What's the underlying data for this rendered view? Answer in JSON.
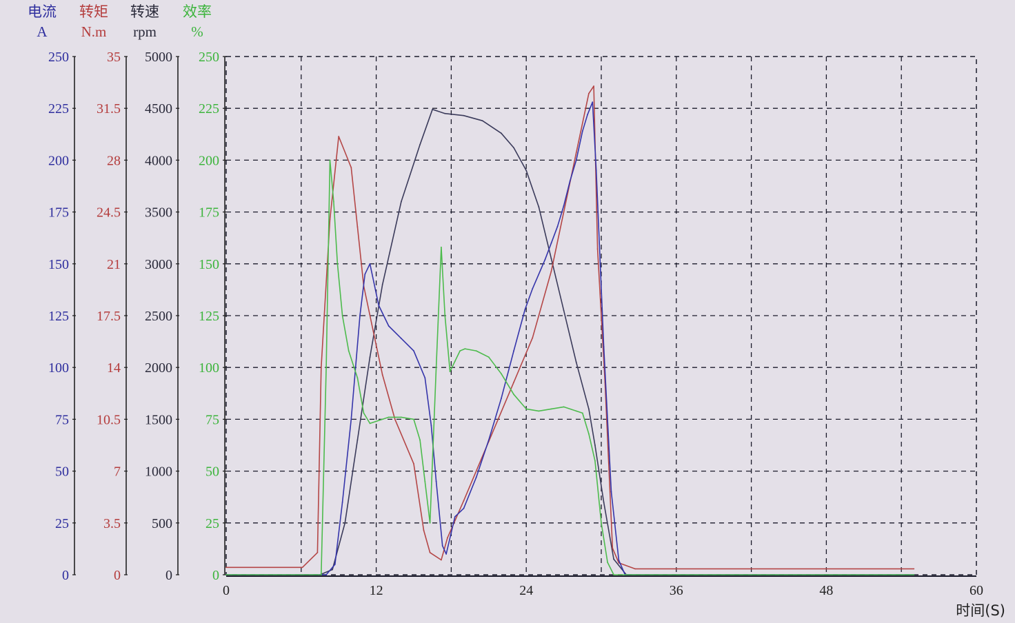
{
  "chart_data": {
    "type": "line",
    "xlabel": "时间(S)",
    "xlim": [
      0,
      60
    ],
    "x_ticks": [
      0,
      12,
      24,
      36,
      48,
      60
    ],
    "x_tick_labels": [
      "0",
      "12",
      "24",
      "36",
      "48",
      "60"
    ],
    "grid": true,
    "axes": [
      {
        "key": "current",
        "name": "电流",
        "unit": "A",
        "range": [
          0,
          250
        ],
        "color": "#2e2e9e",
        "tick_labels": [
          "0",
          "25",
          "50",
          "75",
          "100",
          "125",
          "150",
          "175",
          "200",
          "225",
          "250"
        ]
      },
      {
        "key": "torque",
        "name": "转矩",
        "unit": "N.m",
        "range": [
          0,
          35
        ],
        "color": "#b43c3c",
        "tick_labels": [
          "0",
          "3.5",
          "7",
          "10.5",
          "14",
          "17.5",
          "21",
          "24.5",
          "28",
          "31.5",
          "35"
        ]
      },
      {
        "key": "speed",
        "name": "转速",
        "unit": "rpm",
        "range": [
          0,
          5000
        ],
        "color": "#2a2a3a",
        "tick_labels": [
          "0",
          "500",
          "1000",
          "1500",
          "2000",
          "2500",
          "3000",
          "3500",
          "4000",
          "4500",
          "5000"
        ]
      },
      {
        "key": "efficiency",
        "name": "效率",
        "unit": "%",
        "range": [
          0,
          250
        ],
        "color": "#3cb43c",
        "tick_labels": [
          "0",
          "25",
          "50",
          "75",
          "100",
          "125",
          "150",
          "175",
          "200",
          "225",
          "250"
        ]
      }
    ],
    "series": [
      {
        "axis": "speed",
        "color": "#3a3a5a",
        "x": [
          0,
          7.5,
          8.5,
          9.5,
          10.5,
          11.5,
          12.5,
          14,
          15.5,
          16.5,
          17.5,
          19,
          20.5,
          22,
          23,
          24,
          25,
          26,
          27,
          28,
          29,
          29.5,
          30.2,
          31,
          32,
          55
        ],
        "y": [
          0,
          0,
          50,
          500,
          1300,
          2100,
          2800,
          3600,
          4150,
          4490,
          4450,
          4430,
          4380,
          4260,
          4120,
          3900,
          3550,
          3050,
          2550,
          2050,
          1600,
          1250,
          700,
          150,
          0,
          0
        ]
      },
      {
        "axis": "torque",
        "color": "#b44646",
        "x": [
          0,
          6.1,
          7.3,
          7.6,
          8.3,
          9,
          10,
          10.5,
          11,
          12,
          12.5,
          13.5,
          15,
          15.8,
          16.3,
          17.2,
          17.7,
          19,
          21,
          23,
          24.5,
          26,
          27,
          28,
          29,
          29.4,
          29.7,
          30.3,
          30.9,
          31.4,
          32.7,
          55
        ],
        "y": [
          0.5,
          0.5,
          1.5,
          14,
          24,
          29.6,
          27.5,
          23.5,
          19.5,
          15.5,
          13.5,
          10.5,
          7.5,
          3,
          1.5,
          1,
          2.5,
          5,
          9,
          13,
          16,
          20.5,
          24.5,
          28.5,
          32.5,
          33,
          22,
          13,
          1.8,
          0.8,
          0.4,
          0.4
        ]
      },
      {
        "axis": "current",
        "color": "#3434aa",
        "x": [
          0,
          7,
          8,
          8.7,
          9.3,
          10,
          10.7,
          11.1,
          11.5,
          12.2,
          13,
          14,
          15,
          15.9,
          16.4,
          16.8,
          17.3,
          17.6,
          18.3,
          19,
          20,
          21,
          22,
          23,
          23.9,
          24.5,
          25.5,
          26,
          26.5,
          27,
          27.5,
          28,
          28.5,
          28.9,
          29.3,
          29.6,
          30.2,
          30.8,
          31.4,
          31.9,
          55
        ],
        "y": [
          0,
          0,
          0,
          5,
          35,
          75,
          125,
          145,
          150,
          130,
          120,
          114,
          108,
          95,
          72,
          45,
          14,
          10,
          28,
          32,
          47,
          65,
          85,
          108,
          128,
          138,
          152,
          160,
          168,
          178,
          190,
          200,
          214,
          222,
          228,
          195,
          110,
          40,
          7,
          0,
          0
        ]
      },
      {
        "axis": "efficiency",
        "color": "#4cbb4c",
        "x": [
          0,
          7,
          7.6,
          8,
          8.3,
          8.6,
          8.9,
          9.3,
          9.8,
          10.5,
          11,
          11.5,
          12,
          13,
          14,
          15,
          15.5,
          15.9,
          16.3,
          16.8,
          17.2,
          17.5,
          17.9,
          18.3,
          18.7,
          19.1,
          20,
          21,
          22,
          23,
          24,
          25,
          26,
          27,
          28,
          28.5,
          29,
          29.5,
          30,
          30.5,
          31,
          55
        ],
        "y": [
          0,
          0,
          0,
          100,
          200,
          180,
          150,
          125,
          108,
          95,
          78,
          73,
          74,
          76,
          76,
          75,
          65,
          45,
          25,
          100,
          158,
          125,
          98,
          103,
          108,
          109,
          108,
          105,
          97,
          87,
          80,
          79,
          80,
          81,
          79,
          78,
          68,
          55,
          25,
          6,
          0,
          0
        ]
      }
    ]
  }
}
